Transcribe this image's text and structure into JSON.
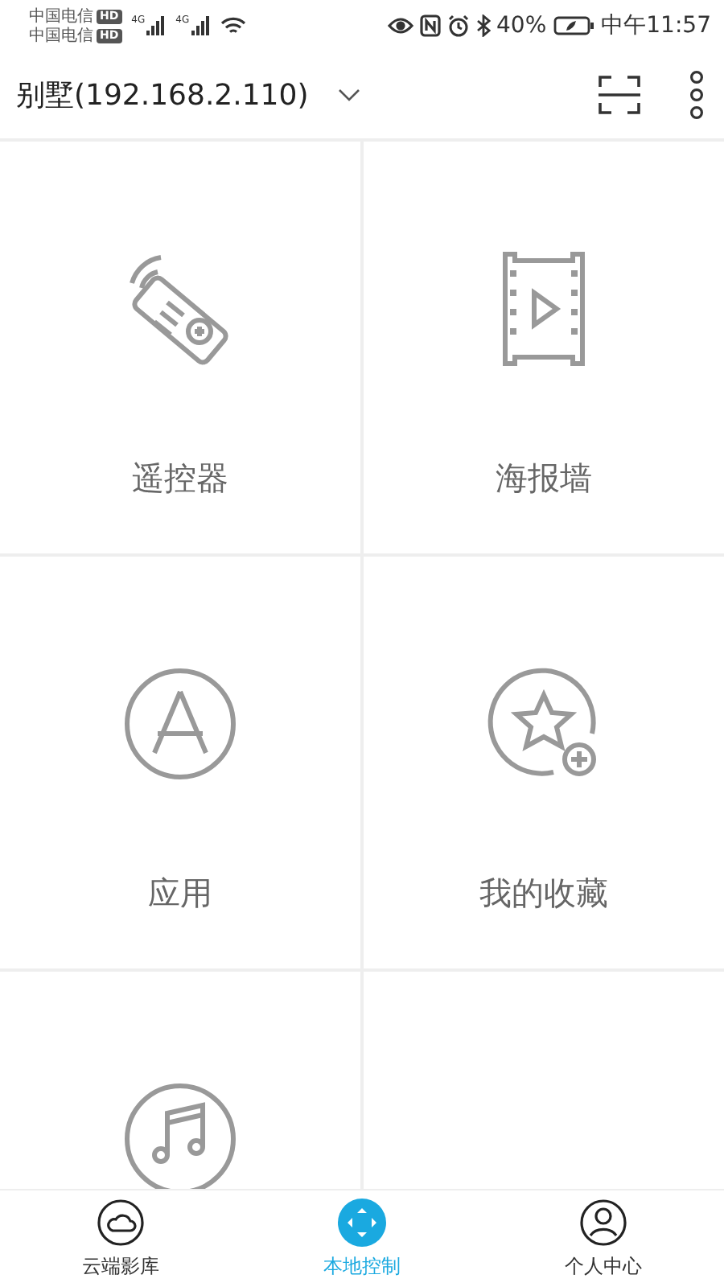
{
  "status_bar": {
    "carriers": [
      {
        "name": "中国电信",
        "badge": "HD"
      },
      {
        "name": "中国电信",
        "badge": "HD"
      }
    ],
    "network_labels": [
      "4G",
      "4G"
    ],
    "battery_text": "40%",
    "time": "中午11:57"
  },
  "header": {
    "title": "别墅(192.168.2.110)"
  },
  "tiles": [
    {
      "kind": "remote",
      "label": "遥控器"
    },
    {
      "kind": "poster",
      "label": "海报墙"
    },
    {
      "kind": "app",
      "label": "应用"
    },
    {
      "kind": "favorite",
      "label": "我的收藏"
    },
    {
      "kind": "music"
    }
  ],
  "nav": [
    {
      "kind": "cloud",
      "label": "云端影库",
      "selected": false
    },
    {
      "kind": "control",
      "label": "本地控制",
      "selected": true
    },
    {
      "kind": "person",
      "label": "个人中心",
      "selected": false
    }
  ]
}
